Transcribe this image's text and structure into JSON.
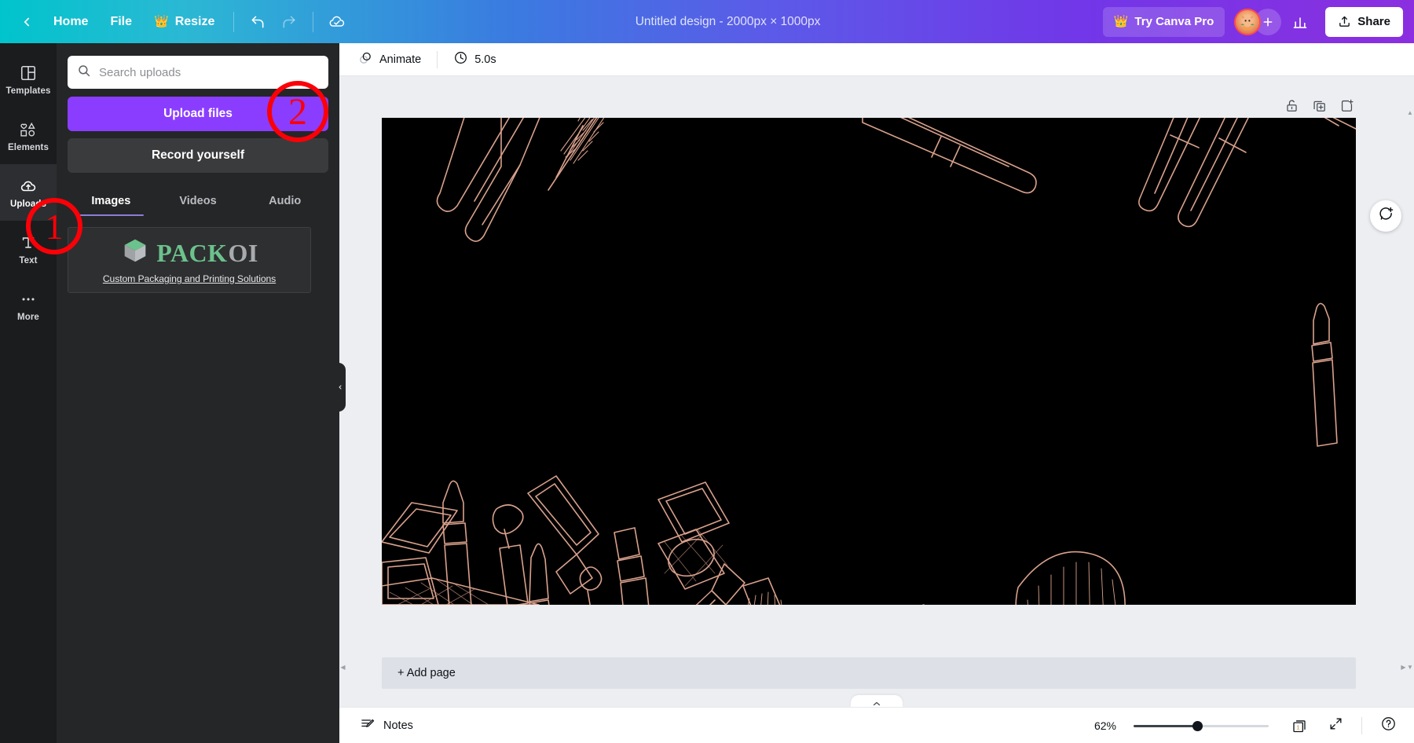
{
  "topbar": {
    "back_icon": "chevron-left-icon",
    "home_label": "Home",
    "file_label": "File",
    "resize_label": "Resize",
    "resize_crown_icon": "crown-icon",
    "undo_icon": "undo-icon",
    "redo_icon": "redo-icon",
    "cloud_saved_icon": "cloud-check-icon",
    "doc_title": "Untitled design - 2000px × 1000px",
    "try_pro_label": "Try Canva Pro",
    "try_pro_crown_icon": "crown-icon",
    "avatar_name": "avatar",
    "add_member_icon": "plus-icon",
    "insights_icon": "bar-chart-icon",
    "share_label": "Share",
    "share_icon": "share-upload-icon",
    "brand_gradient_start": "#00c4cc",
    "brand_gradient_end": "#8b2fe0"
  },
  "rail": {
    "items": [
      {
        "label": "Templates",
        "icon": "templates-grid-icon",
        "active": false
      },
      {
        "label": "Elements",
        "icon": "elements-shapes-icon",
        "active": false
      },
      {
        "label": "Uploads",
        "icon": "uploads-cloud-icon",
        "active": true
      },
      {
        "label": "Text",
        "icon": "text-icon",
        "active": false
      },
      {
        "label": "More",
        "icon": "more-dots-icon",
        "active": false
      }
    ]
  },
  "panel": {
    "search": {
      "placeholder": "Search uploads",
      "value": "",
      "icon": "search-icon"
    },
    "upload_files_label": "Upload files",
    "upload_files_color": "#8b3dff",
    "record_yourself_label": "Record yourself",
    "tabs": [
      {
        "label": "Images",
        "active": true
      },
      {
        "label": "Videos",
        "active": false
      },
      {
        "label": "Audio",
        "active": false
      }
    ],
    "uploads": [
      {
        "name": "packoi-logo-thumbnail",
        "logo_part_1": "PACK",
        "logo_part_2": "OI",
        "logo_part_1_color": "#6cc28c",
        "logo_part_2_color": "#a8abad",
        "tagline": "Custom Packaging and Printing Solutions",
        "box_icon": "3d-box-icon"
      }
    ],
    "collapse_icon": "chevron-left-icon"
  },
  "editor_toolbar": {
    "animate_label": "Animate",
    "animate_icon": "animate-circles-icon",
    "duration_label": "5.0s",
    "duration_icon": "clock-icon"
  },
  "canvas": {
    "page_tools": [
      {
        "name": "lock-page-button",
        "icon": "unlock-icon"
      },
      {
        "name": "duplicate-page-button",
        "icon": "duplicate-icon"
      },
      {
        "name": "add-page-button",
        "icon": "add-page-icon"
      }
    ],
    "comment_fab_icon": "add-comment-icon",
    "add_page_label": "+ Add page",
    "background_color": "#000000",
    "artwork_line_color": "#d9a18c",
    "artwork_description": "makeup cosmetics line-art: mascara wands, brushes, lipsticks, compacts, eyeliner pencil"
  },
  "bottombar": {
    "notes_label": "Notes",
    "notes_icon": "notes-pencil-icon",
    "zoom_percent": "62%",
    "zoom_value": 62,
    "page_count": "1",
    "page_manager_icon": "page-manager-icon",
    "fullscreen_icon": "expand-arrows-icon",
    "help_icon": "help-question-icon",
    "notes_tab_icon": "chevron-up-icon"
  },
  "annotations": [
    {
      "id": "anno-1",
      "label": "1",
      "color": "#fb0007"
    },
    {
      "id": "anno-2",
      "label": "2",
      "color": "#fb0007"
    }
  ]
}
